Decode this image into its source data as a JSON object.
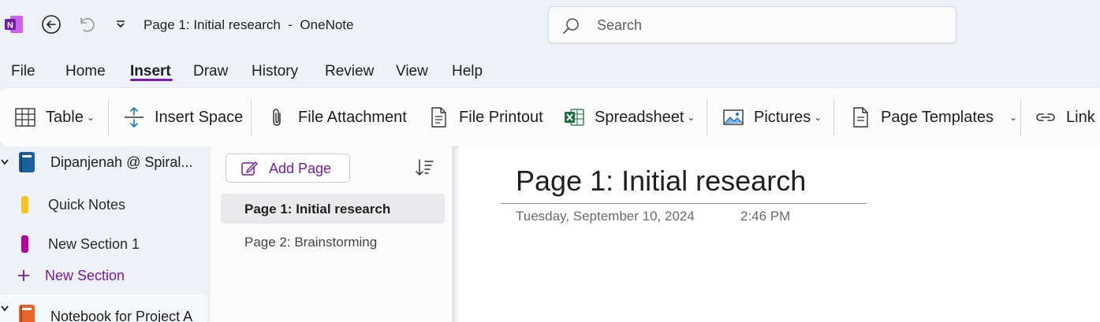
{
  "titlebar": {
    "window_title": "Page 1: Initial research  -  OneNote",
    "search_placeholder": "Search"
  },
  "menu": {
    "tabs": [
      "File",
      "Home",
      "Insert",
      "Draw",
      "History",
      "Review",
      "View",
      "Help"
    ],
    "active": "Insert"
  },
  "ribbon": {
    "table": "Table",
    "insert_space": "Insert Space",
    "file_attachment": "File Attachment",
    "file_printout": "File Printout",
    "spreadsheet": "Spreadsheet",
    "pictures": "Pictures",
    "page_templates": "Page Templates",
    "link": "Link"
  },
  "notebooks": {
    "notebook1": "Dipanjenah @ Spiral...",
    "sections": [
      {
        "label": "Quick Notes",
        "color": "#f5c518"
      },
      {
        "label": "New Section 1",
        "color": "#b4009e"
      }
    ],
    "new_section": "New Section",
    "notebook2": "Notebook for Project A"
  },
  "pages": {
    "add_page": "Add Page",
    "items": [
      "Page 1: Initial research",
      "Page 2: Brainstorming"
    ]
  },
  "canvas": {
    "title": "Page 1: Initial research",
    "date": "Tuesday, September 10, 2024",
    "time": "2:46 PM"
  },
  "colors": {
    "accent": "#7719aa",
    "notebook1": "#1a5f9e",
    "notebook2": "#e8662b"
  }
}
